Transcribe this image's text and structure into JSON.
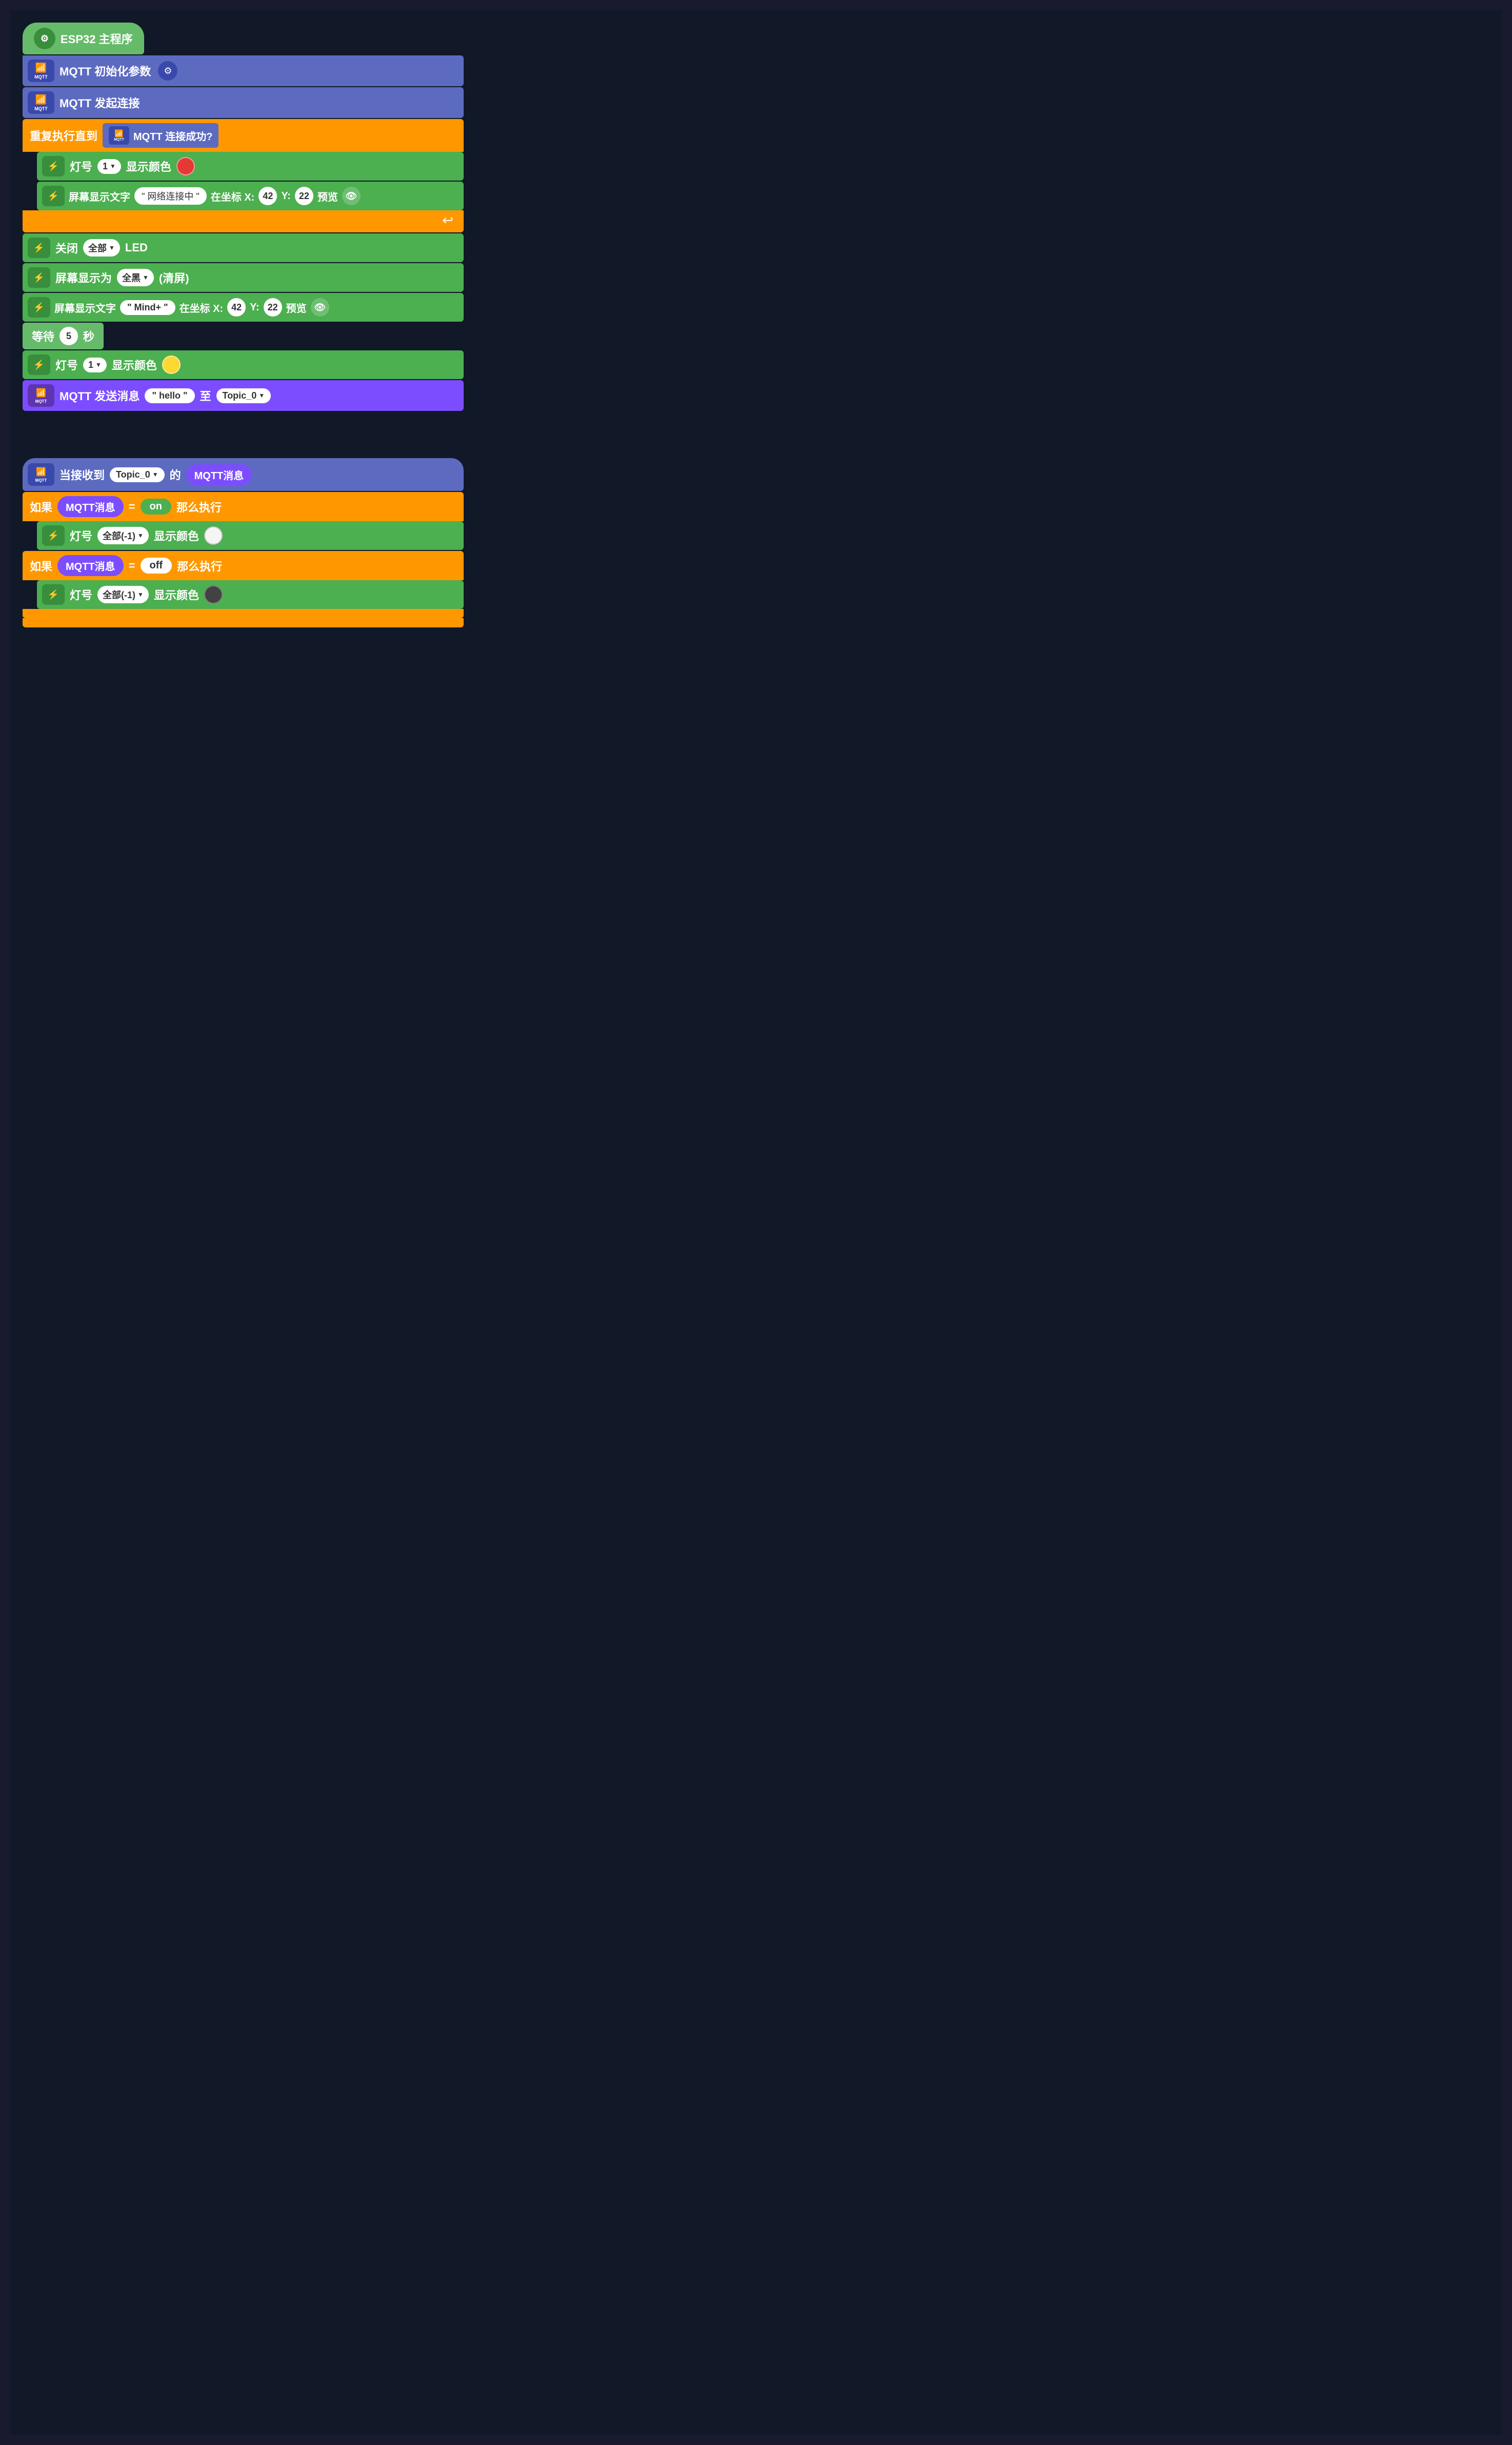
{
  "blocks": {
    "section1": {
      "esp32_label": "ESP32 主程序",
      "mqtt_init_label": "MQTT 初始化参数",
      "mqtt_connect_label": "MQTT 发起连接",
      "loop_label": "重复执行直到",
      "mqtt_connected_label": "MQTT 连接成功?",
      "led1_label": "灯号",
      "led1_num": "1",
      "show_color_label": "显示颜色",
      "screen_text_label": "屏幕显示文字",
      "net_connecting_str": "\" 网络连接中 \"",
      "coord_x_label": "在坐标 X:",
      "coord_x_val": "42",
      "coord_y_label": "Y:",
      "coord_y_val": "22",
      "preview_label": "预览",
      "close_led_label": "关闭",
      "all_label": "全部",
      "led_label": "LED",
      "screen_black_label": "屏幕显示为",
      "black_label": "全黑",
      "clear_label": "(清屏)",
      "screen_mindplus_label": "屏幕显示文字",
      "mindplus_str": "\" Mind+ \"",
      "wait_label": "等待",
      "wait_num": "5",
      "seconds_label": "秒",
      "led2_label": "灯号",
      "led2_num": "1",
      "show_color2_label": "显示颜色",
      "mqtt_send_label": "MQTT 发送消息",
      "hello_str": "\" hello \"",
      "to_label": "至",
      "topic0_label": "Topic_0"
    },
    "section2": {
      "when_receive_label": "当接收到",
      "topic0_recv_label": "Topic_0",
      "of_label": "的",
      "mqtt_msg_label": "MQTT消息",
      "if1_label": "如果",
      "mqtt_msg1_label": "MQTT消息",
      "equals_label": "=",
      "on_label": "on",
      "then_label": "那么执行",
      "led3_label": "灯号",
      "all_minus1_label": "全部(-1)",
      "show_color3_label": "显示颜色",
      "if2_label": "如果",
      "mqtt_msg2_label": "MQTT消息",
      "equals2_label": "=",
      "off_label": "off",
      "then2_label": "那么执行",
      "led4_label": "灯号",
      "all_minus2_label": "全部(-1)",
      "show_color4_label": "显示颜色"
    }
  },
  "colors": {
    "green": "#4caf50",
    "dark_green": "#388e3c",
    "blue_purple": "#5c6bc0",
    "orange": "#ff9800",
    "purple": "#7c4dff",
    "light_green": "#66bb6a",
    "red_dot": "#e53935",
    "yellow_dot": "#fdd835",
    "white_dot": "#f5f5f5",
    "dark_dot": "#424242",
    "background": "#111827"
  }
}
